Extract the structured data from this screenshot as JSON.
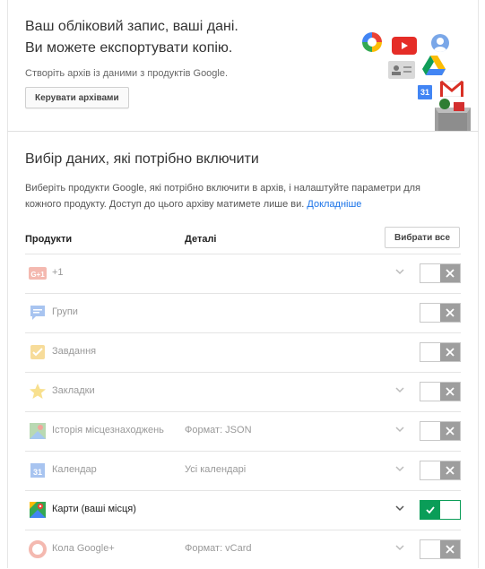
{
  "header": {
    "headline_line1": "Ваш обліковий запис, ваші дані.",
    "headline_line2": "Ви можете експортувати копію.",
    "subtext": "Створіть архів із даними з продуктів Google.",
    "manage_button": "Керувати архівами"
  },
  "section": {
    "title": "Вибір даних, які потрібно включити",
    "description": "Виберіть продукти Google, які потрібно включити в архів, і налаштуйте параметри для кожного продукту. Доступ до цього архіву матимете лише ви.",
    "learn_more": "Докладніше"
  },
  "table": {
    "col_products": "Продукти",
    "col_details": "Деталі",
    "select_all": "Вибрати все",
    "rows": [
      {
        "name": "+1",
        "detail": "",
        "icon": "google-plus-one-icon",
        "expand": true,
        "enabled": false
      },
      {
        "name": "Групи",
        "detail": "",
        "icon": "groups-icon",
        "expand": false,
        "enabled": false
      },
      {
        "name": "Завдання",
        "detail": "",
        "icon": "tasks-icon",
        "expand": false,
        "enabled": false
      },
      {
        "name": "Закладки",
        "detail": "",
        "icon": "bookmarks-star-icon",
        "expand": true,
        "enabled": false
      },
      {
        "name": "Історія місцезнаходжень",
        "detail": "Формат: JSON",
        "icon": "location-history-icon",
        "expand": true,
        "enabled": false
      },
      {
        "name": "Календар",
        "detail": "Усі календарі",
        "icon": "calendar-icon",
        "expand": true,
        "enabled": false
      },
      {
        "name": "Карти (ваші місця)",
        "detail": "",
        "icon": "maps-icon",
        "expand": true,
        "enabled": true
      },
      {
        "name": "Кола Google+",
        "detail": "Формат: vCard",
        "icon": "google-plus-circles-icon",
        "expand": true,
        "enabled": false
      }
    ]
  },
  "icons": {
    "calendar_day": "31"
  },
  "colors": {
    "toggle_on": "#0a9d58",
    "toggle_off": "#9e9e9e",
    "link": "#1a73e8"
  }
}
